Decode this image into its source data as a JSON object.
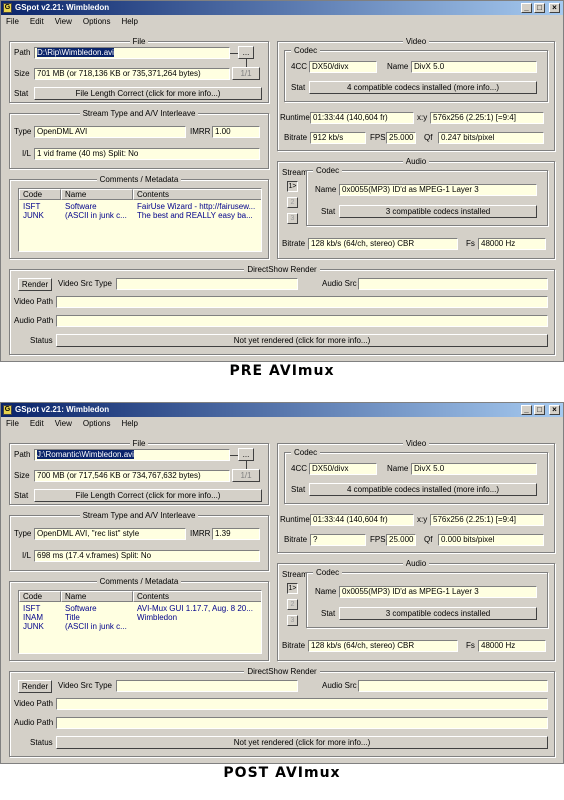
{
  "menu": [
    "File",
    "Edit",
    "View",
    "Options",
    "Help"
  ],
  "labels": {
    "file_group": "File",
    "path": "Path",
    "size": "Size",
    "stat": "Stat",
    "interleave_group": "Stream Type and A/V Interleave",
    "type": "Type",
    "imrr": "IMRR",
    "il": "I/L",
    "comments_group": "Comments / Metadata",
    "col_code": "Code",
    "col_name": "Name",
    "col_contents": "Contents",
    "video_group": "Video",
    "codec_group": "Codec",
    "fourcc": "4CC",
    "name": "Name",
    "runtime": "Runtime",
    "xy": "x:y",
    "bitrate": "Bitrate",
    "fps": "FPS",
    "qf": "Qf",
    "audio_group": "Audio",
    "stream": "Stream",
    "fs": "Fs",
    "render_group": "DirectShow Render",
    "render_btn": "Render",
    "video_src_type": "Video Src Type",
    "audio_src": "Audio Src",
    "video_path": "Video Path",
    "audio_path": "Audio Path",
    "status": "Status",
    "browse_btn": "...",
    "part_btn": "1/1",
    "stream_btns": [
      "1>",
      "2",
      "3"
    ]
  },
  "pre": {
    "title": "GSpot v2.21: Wimbledon",
    "path": "D:\\Rip\\Wimbledon.avi",
    "size": "701 MB (or 718,136 KB or 735,371,264 bytes)",
    "stat_btn": "File Length Correct (click for more info...)",
    "type": "OpenDML AVI",
    "imrr": "1.00",
    "il": "1 vid frame (40 ms)  Split: No",
    "comments": [
      {
        "code": "ISFT",
        "name": "Software",
        "contents": "FairUse Wizard - http://fairusew..."
      },
      {
        "code": "JUNK",
        "name": "(ASCII in junk c...",
        "contents": "The best and REALLY easy ba..."
      }
    ],
    "fourcc": "DX50/divx",
    "codec_name": "DivX 5.0",
    "codec_stat": "4 compatible codecs installed (more info...)",
    "runtime": "01:33:44 (140,604 fr)",
    "xy": "576x256 (2.25:1) [=9:4]",
    "bitrate": "912 kb/s",
    "fps": "25.000",
    "qf": "0.247 bits/pixel",
    "audio_name": "0x0055(MP3) ID'd as MPEG-1 Layer 3",
    "audio_stat": "3 compatible codecs installed",
    "audio_bitrate": "128 kb/s (64/ch, stereo) CBR",
    "fs": "48000 Hz",
    "status": "Not yet rendered (click for more info...)",
    "caption": "PRE AVImux"
  },
  "post": {
    "title": "GSpot v2.21: Wimbledon",
    "path": "J:\\Romantic\\Wimbledon.avi",
    "size": "700 MB (or 717,546 KB or 734,767,632 bytes)",
    "stat_btn": "File Length Correct (click for more info...)",
    "type": "OpenDML AVI, \"rec list\" style",
    "imrr": "1.39",
    "il": "698 ms (17.4 v.frames)  Split: No",
    "comments": [
      {
        "code": "ISFT",
        "name": "Software",
        "contents": "AVI-Mux GUI 1.17.7, Aug. 8 20..."
      },
      {
        "code": "INAM",
        "name": "Title",
        "contents": "Wimbledon"
      },
      {
        "code": "JUNK",
        "name": "(ASCII in junk c...",
        "contents": ""
      }
    ],
    "fourcc": "DX50/divx",
    "codec_name": "DivX 5.0",
    "codec_stat": "4 compatible codecs installed (more info...)",
    "runtime": "01:33:44 (140,604 fr)",
    "xy": "576x256 (2.25:1) [=9:4]",
    "bitrate": "?",
    "fps": "25.000",
    "qf": "0.000 bits/pixel",
    "audio_name": "0x0055(MP3) ID'd as MPEG-1 Layer 3",
    "audio_stat": "3 compatible codecs installed",
    "audio_bitrate": "128 kb/s (64/ch, stereo) CBR",
    "fs": "48000 Hz",
    "status": "Not yet rendered (click for more info...)",
    "caption": "POST AVImux"
  }
}
